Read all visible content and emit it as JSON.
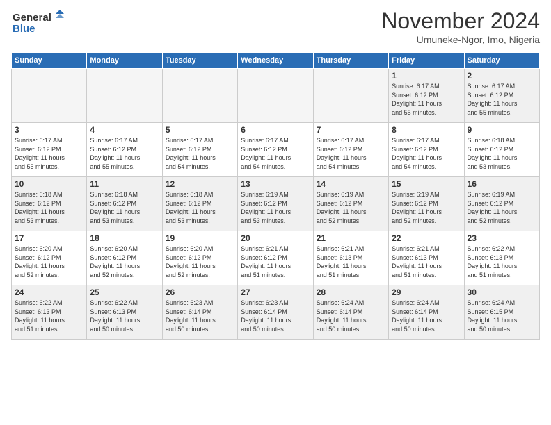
{
  "logo": {
    "line1": "General",
    "line2": "Blue"
  },
  "title": "November 2024",
  "location": "Umuneke-Ngor, Imo, Nigeria",
  "weekdays": [
    "Sunday",
    "Monday",
    "Tuesday",
    "Wednesday",
    "Thursday",
    "Friday",
    "Saturday"
  ],
  "weeks": [
    [
      {
        "day": "",
        "detail": "",
        "empty": true
      },
      {
        "day": "",
        "detail": "",
        "empty": true
      },
      {
        "day": "",
        "detail": "",
        "empty": true
      },
      {
        "day": "",
        "detail": "",
        "empty": true
      },
      {
        "day": "",
        "detail": "",
        "empty": true
      },
      {
        "day": "1",
        "detail": "Sunrise: 6:17 AM\nSunset: 6:12 PM\nDaylight: 11 hours\nand 55 minutes.",
        "empty": false
      },
      {
        "day": "2",
        "detail": "Sunrise: 6:17 AM\nSunset: 6:12 PM\nDaylight: 11 hours\nand 55 minutes.",
        "empty": false
      }
    ],
    [
      {
        "day": "3",
        "detail": "Sunrise: 6:17 AM\nSunset: 6:12 PM\nDaylight: 11 hours\nand 55 minutes.",
        "empty": false
      },
      {
        "day": "4",
        "detail": "Sunrise: 6:17 AM\nSunset: 6:12 PM\nDaylight: 11 hours\nand 55 minutes.",
        "empty": false
      },
      {
        "day": "5",
        "detail": "Sunrise: 6:17 AM\nSunset: 6:12 PM\nDaylight: 11 hours\nand 54 minutes.",
        "empty": false
      },
      {
        "day": "6",
        "detail": "Sunrise: 6:17 AM\nSunset: 6:12 PM\nDaylight: 11 hours\nand 54 minutes.",
        "empty": false
      },
      {
        "day": "7",
        "detail": "Sunrise: 6:17 AM\nSunset: 6:12 PM\nDaylight: 11 hours\nand 54 minutes.",
        "empty": false
      },
      {
        "day": "8",
        "detail": "Sunrise: 6:17 AM\nSunset: 6:12 PM\nDaylight: 11 hours\nand 54 minutes.",
        "empty": false
      },
      {
        "day": "9",
        "detail": "Sunrise: 6:18 AM\nSunset: 6:12 PM\nDaylight: 11 hours\nand 53 minutes.",
        "empty": false
      }
    ],
    [
      {
        "day": "10",
        "detail": "Sunrise: 6:18 AM\nSunset: 6:12 PM\nDaylight: 11 hours\nand 53 minutes.",
        "empty": false
      },
      {
        "day": "11",
        "detail": "Sunrise: 6:18 AM\nSunset: 6:12 PM\nDaylight: 11 hours\nand 53 minutes.",
        "empty": false
      },
      {
        "day": "12",
        "detail": "Sunrise: 6:18 AM\nSunset: 6:12 PM\nDaylight: 11 hours\nand 53 minutes.",
        "empty": false
      },
      {
        "day": "13",
        "detail": "Sunrise: 6:19 AM\nSunset: 6:12 PM\nDaylight: 11 hours\nand 53 minutes.",
        "empty": false
      },
      {
        "day": "14",
        "detail": "Sunrise: 6:19 AM\nSunset: 6:12 PM\nDaylight: 11 hours\nand 52 minutes.",
        "empty": false
      },
      {
        "day": "15",
        "detail": "Sunrise: 6:19 AM\nSunset: 6:12 PM\nDaylight: 11 hours\nand 52 minutes.",
        "empty": false
      },
      {
        "day": "16",
        "detail": "Sunrise: 6:19 AM\nSunset: 6:12 PM\nDaylight: 11 hours\nand 52 minutes.",
        "empty": false
      }
    ],
    [
      {
        "day": "17",
        "detail": "Sunrise: 6:20 AM\nSunset: 6:12 PM\nDaylight: 11 hours\nand 52 minutes.",
        "empty": false
      },
      {
        "day": "18",
        "detail": "Sunrise: 6:20 AM\nSunset: 6:12 PM\nDaylight: 11 hours\nand 52 minutes.",
        "empty": false
      },
      {
        "day": "19",
        "detail": "Sunrise: 6:20 AM\nSunset: 6:12 PM\nDaylight: 11 hours\nand 52 minutes.",
        "empty": false
      },
      {
        "day": "20",
        "detail": "Sunrise: 6:21 AM\nSunset: 6:12 PM\nDaylight: 11 hours\nand 51 minutes.",
        "empty": false
      },
      {
        "day": "21",
        "detail": "Sunrise: 6:21 AM\nSunset: 6:13 PM\nDaylight: 11 hours\nand 51 minutes.",
        "empty": false
      },
      {
        "day": "22",
        "detail": "Sunrise: 6:21 AM\nSunset: 6:13 PM\nDaylight: 11 hours\nand 51 minutes.",
        "empty": false
      },
      {
        "day": "23",
        "detail": "Sunrise: 6:22 AM\nSunset: 6:13 PM\nDaylight: 11 hours\nand 51 minutes.",
        "empty": false
      }
    ],
    [
      {
        "day": "24",
        "detail": "Sunrise: 6:22 AM\nSunset: 6:13 PM\nDaylight: 11 hours\nand 51 minutes.",
        "empty": false
      },
      {
        "day": "25",
        "detail": "Sunrise: 6:22 AM\nSunset: 6:13 PM\nDaylight: 11 hours\nand 50 minutes.",
        "empty": false
      },
      {
        "day": "26",
        "detail": "Sunrise: 6:23 AM\nSunset: 6:14 PM\nDaylight: 11 hours\nand 50 minutes.",
        "empty": false
      },
      {
        "day": "27",
        "detail": "Sunrise: 6:23 AM\nSunset: 6:14 PM\nDaylight: 11 hours\nand 50 minutes.",
        "empty": false
      },
      {
        "day": "28",
        "detail": "Sunrise: 6:24 AM\nSunset: 6:14 PM\nDaylight: 11 hours\nand 50 minutes.",
        "empty": false
      },
      {
        "day": "29",
        "detail": "Sunrise: 6:24 AM\nSunset: 6:14 PM\nDaylight: 11 hours\nand 50 minutes.",
        "empty": false
      },
      {
        "day": "30",
        "detail": "Sunrise: 6:24 AM\nSunset: 6:15 PM\nDaylight: 11 hours\nand 50 minutes.",
        "empty": false
      }
    ]
  ]
}
